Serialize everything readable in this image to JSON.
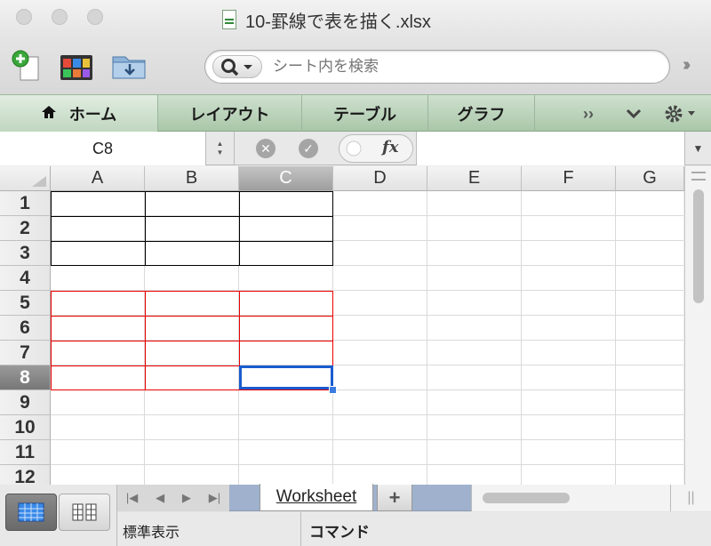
{
  "window": {
    "title": "10-罫線で表を描く.xlsx"
  },
  "toolbar": {
    "search_placeholder": "シート内を検索"
  },
  "ribbon": {
    "tabs": [
      "ホーム",
      "レイアウト",
      "テーブル",
      "グラフ"
    ]
  },
  "formula_bar": {
    "name_box": "C8",
    "fx": "fx",
    "formula": ""
  },
  "grid": {
    "columns": [
      "A",
      "B",
      "C",
      "D",
      "E",
      "F",
      "G"
    ],
    "rows": [
      "1",
      "2",
      "3",
      "4",
      "5",
      "6",
      "7",
      "8",
      "9",
      "10",
      "11",
      "12"
    ],
    "selected_column": "C",
    "selected_row": "8",
    "active_cell": "C8",
    "black_border_range": "A1:C3",
    "red_border_range": "A5:C8",
    "colors": {
      "black_border": "#000000",
      "red_border": "#e00000",
      "selection": "#1a5ccf"
    }
  },
  "sheets": {
    "active": "Worksheet",
    "add_label": "+"
  },
  "status_bar": {
    "view": "標準表示",
    "mode": "コマンド"
  },
  "colors": {
    "ribbon": "#b5cfb5",
    "sheet_bar": "#9fb1cc"
  }
}
